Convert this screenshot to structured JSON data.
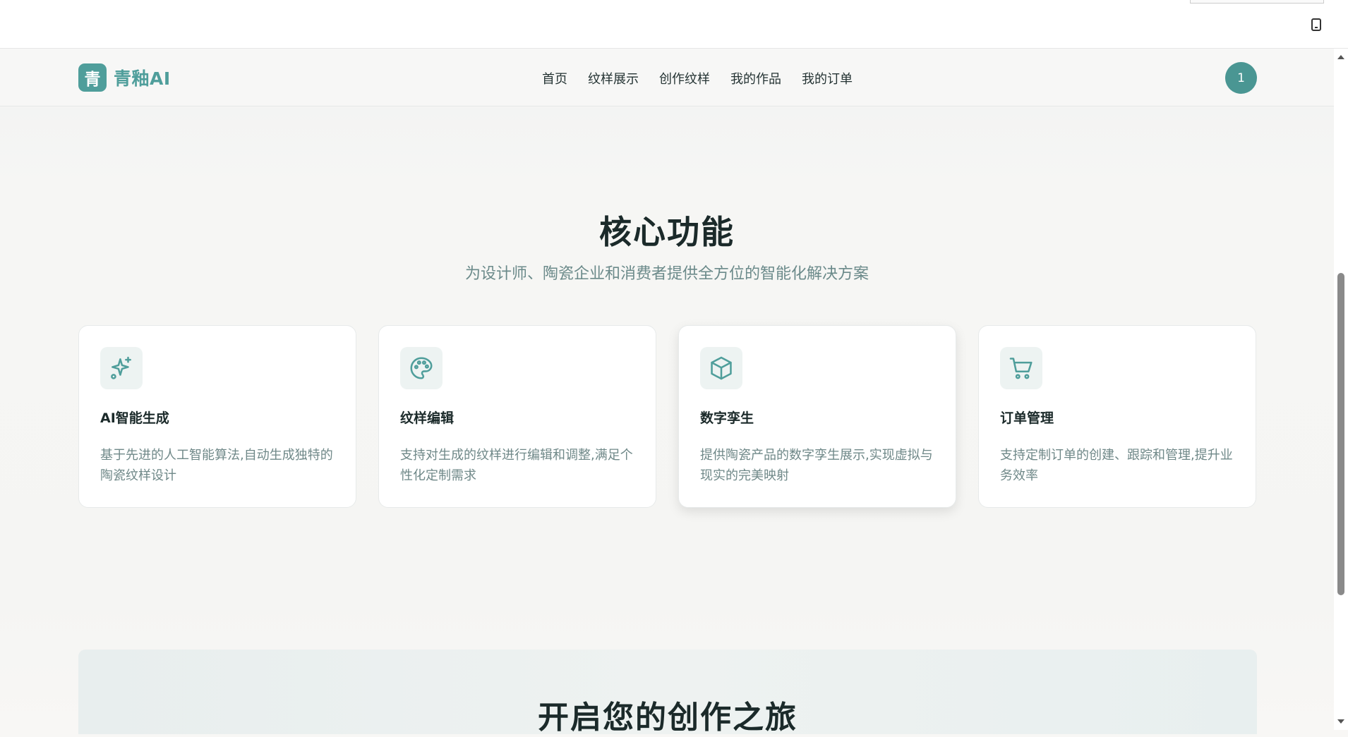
{
  "brand": {
    "mark": "青",
    "name": "青釉AI",
    "accent": "#4f9e9b"
  },
  "nav": {
    "items": [
      {
        "label": "首页"
      },
      {
        "label": "纹样展示"
      },
      {
        "label": "创作纹样"
      },
      {
        "label": "我的作品"
      },
      {
        "label": "我的订单"
      }
    ]
  },
  "user": {
    "avatar_label": "1"
  },
  "features": {
    "title": "核心功能",
    "subtitle": "为设计师、陶瓷企业和消费者提供全方位的智能化解决方案",
    "cards": [
      {
        "icon": "sparkles-icon",
        "title": "AI智能生成",
        "desc": "基于先进的人工智能算法,自动生成独特的陶瓷纹样设计"
      },
      {
        "icon": "palette-icon",
        "title": "纹样编辑",
        "desc": "支持对生成的纹样进行编辑和调整,满足个性化定制需求"
      },
      {
        "icon": "cube-icon",
        "title": "数字孪生",
        "desc": "提供陶瓷产品的数字孪生展示,实现虚拟与现实的完美映射"
      },
      {
        "icon": "cart-icon",
        "title": "订单管理",
        "desc": "支持定制订单的创建、跟踪和管理,提升业务效率"
      }
    ]
  },
  "cta": {
    "title": "开启您的创作之旅"
  }
}
